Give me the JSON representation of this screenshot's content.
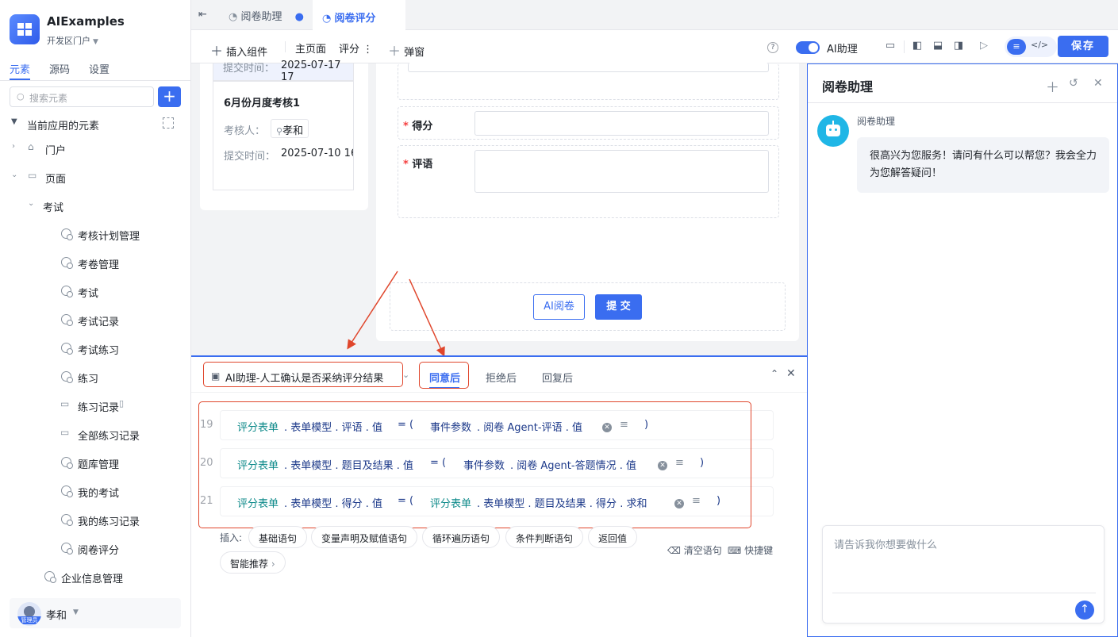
{
  "app": {
    "name": "AIExamples",
    "portal": "开发区门户"
  },
  "sidebar": {
    "tabs": [
      "元素",
      "源码",
      "设置"
    ],
    "search_placeholder": "搜索元素",
    "section_title": "当前应用的元素",
    "tree": [
      {
        "label": "门户"
      },
      {
        "label": "页面"
      },
      {
        "label": "考试"
      },
      {
        "label": "考核计划管理"
      },
      {
        "label": "考卷管理"
      },
      {
        "label": "考试"
      },
      {
        "label": "考试记录"
      },
      {
        "label": "考试练习"
      },
      {
        "label": "练习"
      },
      {
        "label": "练习记录"
      },
      {
        "label": "全部练习记录"
      },
      {
        "label": "题库管理"
      },
      {
        "label": "我的考试"
      },
      {
        "label": "我的练习记录"
      },
      {
        "label": "阅卷评分"
      },
      {
        "label": "企业信息管理"
      }
    ],
    "user": {
      "name": "孝和",
      "role_tag": "管理员"
    }
  },
  "tabs": [
    {
      "label": "阅卷助理"
    },
    {
      "label": "阅卷评分"
    }
  ],
  "toolbar": {
    "insert_component": "插入组件",
    "main_page": "主页面",
    "score": "评分",
    "dialog": "弹窗",
    "ai_assistant": "AI助理",
    "save": "保存"
  },
  "canvas": {
    "list": {
      "top_label": "提交时间：",
      "top_value": "2025-07-17 17",
      "card_title": "6月份月度考核1",
      "reviewer_label": "考核人：",
      "reviewer": "孝和",
      "submit_label": "提交时间：",
      "submit_value": "2025-07-10 16"
    },
    "form": {
      "score_label": "得分",
      "comment_label": "评语",
      "ai_read_button": "AI阅卷",
      "submit_button": "提 交"
    }
  },
  "event_panel": {
    "title": "AI助理-人工确认是否采纳评分结果",
    "tabs": [
      "同意后",
      "拒绝后",
      "回复后"
    ],
    "rows": [
      {
        "line": "19",
        "target": "评分表单",
        "path": ". 表单模型 . 评语 . 值",
        "op": "=  (",
        "source_a": "事件参数",
        "source_b": ". 阅卷 Agent-评语 . 值",
        "close": ")"
      },
      {
        "line": "20",
        "target": "评分表单",
        "path": ". 表单模型 . 题目及结果 . 值",
        "op": "=  (",
        "source_a": "事件参数",
        "source_b": ". 阅卷 Agent-答题情况 . 值",
        "close": ")"
      },
      {
        "line": "21",
        "target": "评分表单",
        "path": ". 表单模型 . 得分 . 值",
        "op": "=  (",
        "source_a": "评分表单",
        "source_b": ". 表单模型 . 题目及结果 . 得分 . 求和",
        "close": ")"
      }
    ],
    "insert_label": "插入:",
    "insert_chips": [
      "基础语句",
      "变量声明及赋值语句",
      "循环遍历语句",
      "条件判断语句",
      "返回值"
    ],
    "smart_recommend": "智能推荐",
    "clear": "清空语句",
    "shortcut": "快捷键"
  },
  "assistant": {
    "title": "阅卷助理",
    "bot_name": "阅卷助理",
    "message": "很高兴为您服务！请问有什么可以帮您？我会全力为您解答疑问！",
    "input_placeholder": "请告诉我你想要做什么"
  }
}
